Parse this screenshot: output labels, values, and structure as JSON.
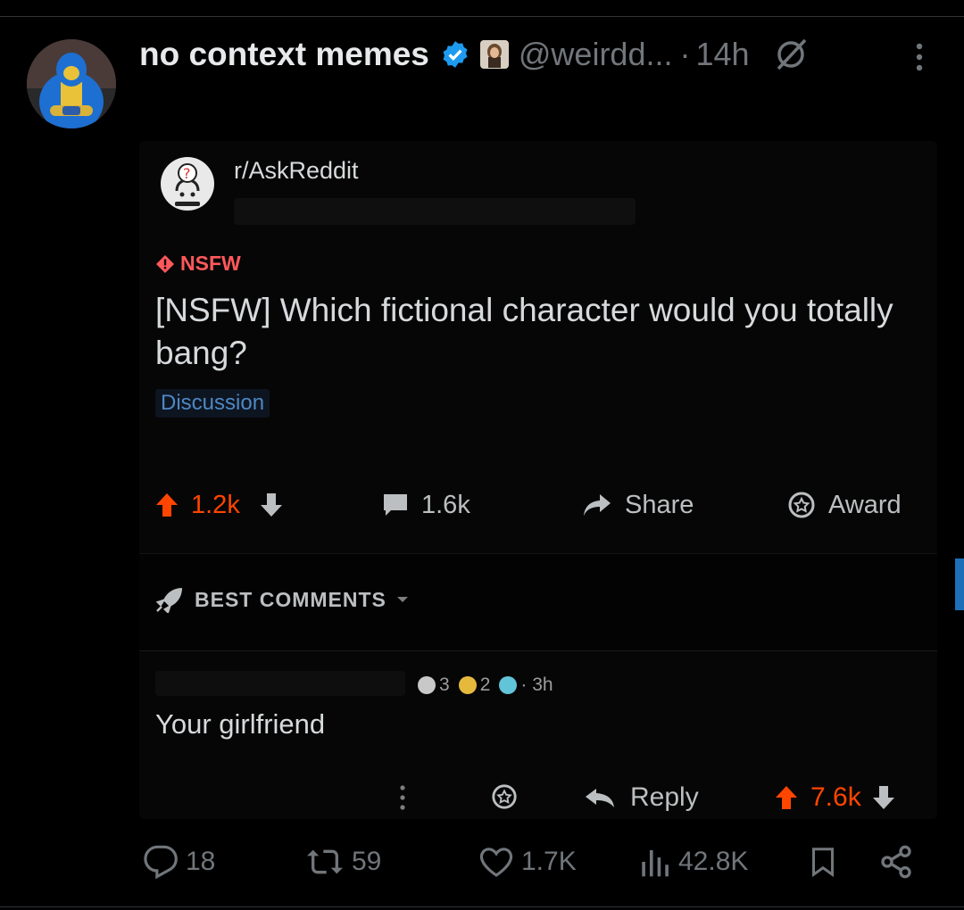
{
  "tweet": {
    "display_name": "no context memes",
    "handle": "@weirdd...",
    "separator": "·",
    "time": "14h",
    "icons": {
      "verified": "verified-badge-icon",
      "grok": "grok-icon",
      "more": "more-vertical-icon"
    },
    "accent": "#1d9bf0"
  },
  "reddit": {
    "subreddit": "r/AskReddit",
    "nsfw_tag": "NSFW",
    "title": "[NSFW] Which fictional character would you totally bang?",
    "flair": "Discussion",
    "upvotes": "1.2k",
    "comments": "1.6k",
    "share": "Share",
    "award": "Award",
    "sort": "BEST COMMENTS",
    "comment": {
      "award1_count": "3",
      "award2_count": "2",
      "age": "· 3h",
      "text": "Your girlfriend",
      "reply": "Reply",
      "score": "7.6k"
    },
    "colors": {
      "upvote": "#ff4500",
      "nsfw": "#ff585b",
      "flair": "#4f87c4"
    }
  },
  "footer": {
    "replies": "18",
    "reposts": "59",
    "likes": "1.7K",
    "views": "42.8K",
    "icons": [
      "reply-icon",
      "repost-icon",
      "like-icon",
      "views-icon",
      "bookmark-icon",
      "share-icon"
    ]
  }
}
